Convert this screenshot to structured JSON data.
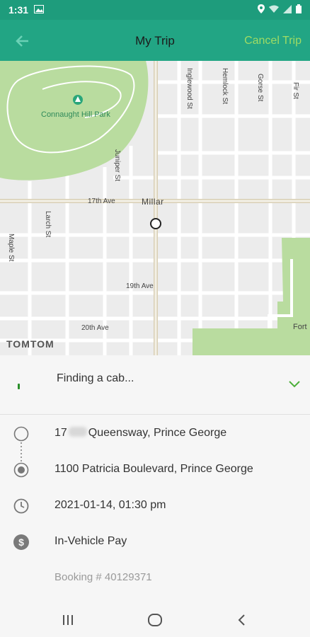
{
  "status_bar": {
    "time": "1:31"
  },
  "header": {
    "title": "My Trip",
    "cancel_label": "Cancel Trip"
  },
  "map": {
    "park_label": "Connaught Hill Park",
    "brand": "TOMTOM",
    "area_label": "Millar",
    "edge_label": "Fort",
    "streets": {
      "inglewood": "Inglewood St",
      "hemlock": "Hemlock St",
      "gorse": "Gorse St",
      "fir": "Fir St",
      "juniper": "Juniper St",
      "larch": "Larch St",
      "maple": "Maple St",
      "ave17": "17th Ave",
      "ave19": "19th Ave",
      "ave20": "20th Ave"
    }
  },
  "trip": {
    "status": "Finding a cab...",
    "pickup_prefix": "17",
    "pickup_suffix": "Queensway, Prince George",
    "dropoff": "1100 Patricia Boulevard, Prince George",
    "datetime": "2021-01-14, 01:30 pm",
    "payment": "In-Vehicle Pay",
    "booking": "Booking # 40129371"
  },
  "colors": {
    "header": "#22a584",
    "status_bar": "#1e9c7c",
    "cancel": "#9fdb64",
    "park": "#b9dc9f"
  }
}
